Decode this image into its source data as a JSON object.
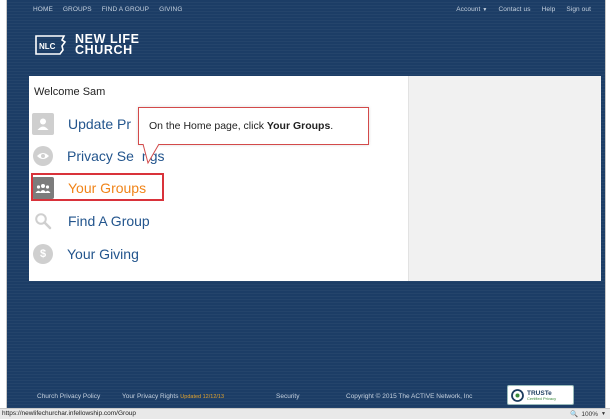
{
  "top_nav": {
    "left_links": [
      "HOME",
      "GROUPS",
      "FIND A GROUP",
      "GIVING"
    ],
    "right_links": [
      "Account",
      "Contact us",
      "Help",
      "Sign out"
    ]
  },
  "logo": {
    "mark": "NLC",
    "line1": "NEW LIFE",
    "line2": "CHURCH"
  },
  "welcome": "Welcome Sam",
  "menu": [
    {
      "label": "Update Pr",
      "icon": "person-icon"
    },
    {
      "label": "Privacy Se",
      "label_tail": "ngs",
      "icon": "eye-icon"
    },
    {
      "label": "Your Groups",
      "icon": "group-icon",
      "active": true
    },
    {
      "label": "Find A Group",
      "icon": "magnifier-icon"
    },
    {
      "label": "Your Giving",
      "icon": "dollar-icon"
    }
  ],
  "tooltip": {
    "prefix": "On the Home page, click ",
    "bold": "Your Groups",
    "suffix": "."
  },
  "footer": {
    "links": [
      "Church Privacy Policy",
      "Your Privacy Rights",
      "Security"
    ],
    "updated": "Updated 12/12/13",
    "copyright": "Copyright © 2015 The ACTIVE Network, Inc",
    "truste_name": "TRUSTe",
    "truste_sub": "Certified Privacy"
  },
  "status_bar": {
    "url": "https://newlifechurchar.infellowship.com/Group",
    "zoom": "100%"
  },
  "colors": {
    "frame": "#1c3d66",
    "link": "#23558d",
    "active": "#f08419",
    "highlight": "#d9323a"
  }
}
